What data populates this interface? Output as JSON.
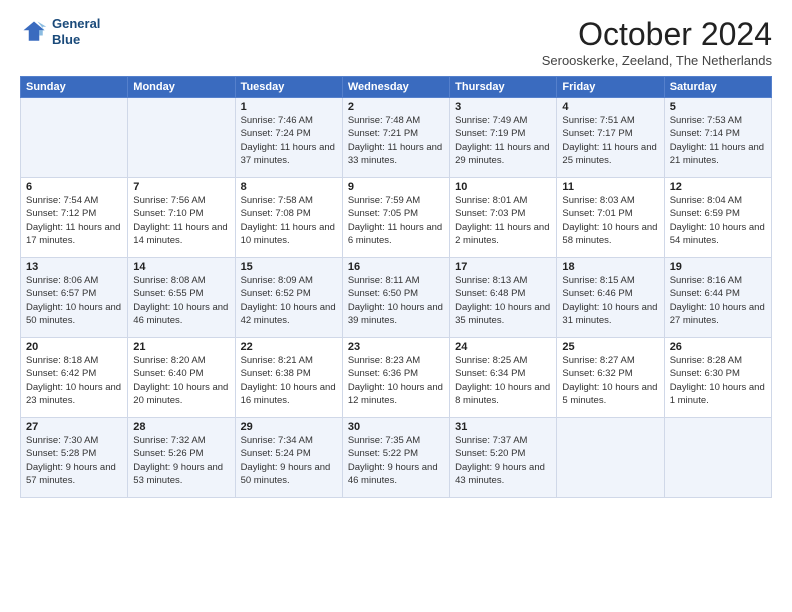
{
  "header": {
    "logo_line1": "General",
    "logo_line2": "Blue",
    "month_title": "October 2024",
    "location": "Serooskerke, Zeeland, The Netherlands"
  },
  "days_of_week": [
    "Sunday",
    "Monday",
    "Tuesday",
    "Wednesday",
    "Thursday",
    "Friday",
    "Saturday"
  ],
  "weeks": [
    [
      {
        "num": "",
        "sunrise": "",
        "sunset": "",
        "daylight": ""
      },
      {
        "num": "",
        "sunrise": "",
        "sunset": "",
        "daylight": ""
      },
      {
        "num": "1",
        "sunrise": "Sunrise: 7:46 AM",
        "sunset": "Sunset: 7:24 PM",
        "daylight": "Daylight: 11 hours and 37 minutes."
      },
      {
        "num": "2",
        "sunrise": "Sunrise: 7:48 AM",
        "sunset": "Sunset: 7:21 PM",
        "daylight": "Daylight: 11 hours and 33 minutes."
      },
      {
        "num": "3",
        "sunrise": "Sunrise: 7:49 AM",
        "sunset": "Sunset: 7:19 PM",
        "daylight": "Daylight: 11 hours and 29 minutes."
      },
      {
        "num": "4",
        "sunrise": "Sunrise: 7:51 AM",
        "sunset": "Sunset: 7:17 PM",
        "daylight": "Daylight: 11 hours and 25 minutes."
      },
      {
        "num": "5",
        "sunrise": "Sunrise: 7:53 AM",
        "sunset": "Sunset: 7:14 PM",
        "daylight": "Daylight: 11 hours and 21 minutes."
      }
    ],
    [
      {
        "num": "6",
        "sunrise": "Sunrise: 7:54 AM",
        "sunset": "Sunset: 7:12 PM",
        "daylight": "Daylight: 11 hours and 17 minutes."
      },
      {
        "num": "7",
        "sunrise": "Sunrise: 7:56 AM",
        "sunset": "Sunset: 7:10 PM",
        "daylight": "Daylight: 11 hours and 14 minutes."
      },
      {
        "num": "8",
        "sunrise": "Sunrise: 7:58 AM",
        "sunset": "Sunset: 7:08 PM",
        "daylight": "Daylight: 11 hours and 10 minutes."
      },
      {
        "num": "9",
        "sunrise": "Sunrise: 7:59 AM",
        "sunset": "Sunset: 7:05 PM",
        "daylight": "Daylight: 11 hours and 6 minutes."
      },
      {
        "num": "10",
        "sunrise": "Sunrise: 8:01 AM",
        "sunset": "Sunset: 7:03 PM",
        "daylight": "Daylight: 11 hours and 2 minutes."
      },
      {
        "num": "11",
        "sunrise": "Sunrise: 8:03 AM",
        "sunset": "Sunset: 7:01 PM",
        "daylight": "Daylight: 10 hours and 58 minutes."
      },
      {
        "num": "12",
        "sunrise": "Sunrise: 8:04 AM",
        "sunset": "Sunset: 6:59 PM",
        "daylight": "Daylight: 10 hours and 54 minutes."
      }
    ],
    [
      {
        "num": "13",
        "sunrise": "Sunrise: 8:06 AM",
        "sunset": "Sunset: 6:57 PM",
        "daylight": "Daylight: 10 hours and 50 minutes."
      },
      {
        "num": "14",
        "sunrise": "Sunrise: 8:08 AM",
        "sunset": "Sunset: 6:55 PM",
        "daylight": "Daylight: 10 hours and 46 minutes."
      },
      {
        "num": "15",
        "sunrise": "Sunrise: 8:09 AM",
        "sunset": "Sunset: 6:52 PM",
        "daylight": "Daylight: 10 hours and 42 minutes."
      },
      {
        "num": "16",
        "sunrise": "Sunrise: 8:11 AM",
        "sunset": "Sunset: 6:50 PM",
        "daylight": "Daylight: 10 hours and 39 minutes."
      },
      {
        "num": "17",
        "sunrise": "Sunrise: 8:13 AM",
        "sunset": "Sunset: 6:48 PM",
        "daylight": "Daylight: 10 hours and 35 minutes."
      },
      {
        "num": "18",
        "sunrise": "Sunrise: 8:15 AM",
        "sunset": "Sunset: 6:46 PM",
        "daylight": "Daylight: 10 hours and 31 minutes."
      },
      {
        "num": "19",
        "sunrise": "Sunrise: 8:16 AM",
        "sunset": "Sunset: 6:44 PM",
        "daylight": "Daylight: 10 hours and 27 minutes."
      }
    ],
    [
      {
        "num": "20",
        "sunrise": "Sunrise: 8:18 AM",
        "sunset": "Sunset: 6:42 PM",
        "daylight": "Daylight: 10 hours and 23 minutes."
      },
      {
        "num": "21",
        "sunrise": "Sunrise: 8:20 AM",
        "sunset": "Sunset: 6:40 PM",
        "daylight": "Daylight: 10 hours and 20 minutes."
      },
      {
        "num": "22",
        "sunrise": "Sunrise: 8:21 AM",
        "sunset": "Sunset: 6:38 PM",
        "daylight": "Daylight: 10 hours and 16 minutes."
      },
      {
        "num": "23",
        "sunrise": "Sunrise: 8:23 AM",
        "sunset": "Sunset: 6:36 PM",
        "daylight": "Daylight: 10 hours and 12 minutes."
      },
      {
        "num": "24",
        "sunrise": "Sunrise: 8:25 AM",
        "sunset": "Sunset: 6:34 PM",
        "daylight": "Daylight: 10 hours and 8 minutes."
      },
      {
        "num": "25",
        "sunrise": "Sunrise: 8:27 AM",
        "sunset": "Sunset: 6:32 PM",
        "daylight": "Daylight: 10 hours and 5 minutes."
      },
      {
        "num": "26",
        "sunrise": "Sunrise: 8:28 AM",
        "sunset": "Sunset: 6:30 PM",
        "daylight": "Daylight: 10 hours and 1 minute."
      }
    ],
    [
      {
        "num": "27",
        "sunrise": "Sunrise: 7:30 AM",
        "sunset": "Sunset: 5:28 PM",
        "daylight": "Daylight: 9 hours and 57 minutes."
      },
      {
        "num": "28",
        "sunrise": "Sunrise: 7:32 AM",
        "sunset": "Sunset: 5:26 PM",
        "daylight": "Daylight: 9 hours and 53 minutes."
      },
      {
        "num": "29",
        "sunrise": "Sunrise: 7:34 AM",
        "sunset": "Sunset: 5:24 PM",
        "daylight": "Daylight: 9 hours and 50 minutes."
      },
      {
        "num": "30",
        "sunrise": "Sunrise: 7:35 AM",
        "sunset": "Sunset: 5:22 PM",
        "daylight": "Daylight: 9 hours and 46 minutes."
      },
      {
        "num": "31",
        "sunrise": "Sunrise: 7:37 AM",
        "sunset": "Sunset: 5:20 PM",
        "daylight": "Daylight: 9 hours and 43 minutes."
      },
      {
        "num": "",
        "sunrise": "",
        "sunset": "",
        "daylight": ""
      },
      {
        "num": "",
        "sunrise": "",
        "sunset": "",
        "daylight": ""
      }
    ]
  ]
}
